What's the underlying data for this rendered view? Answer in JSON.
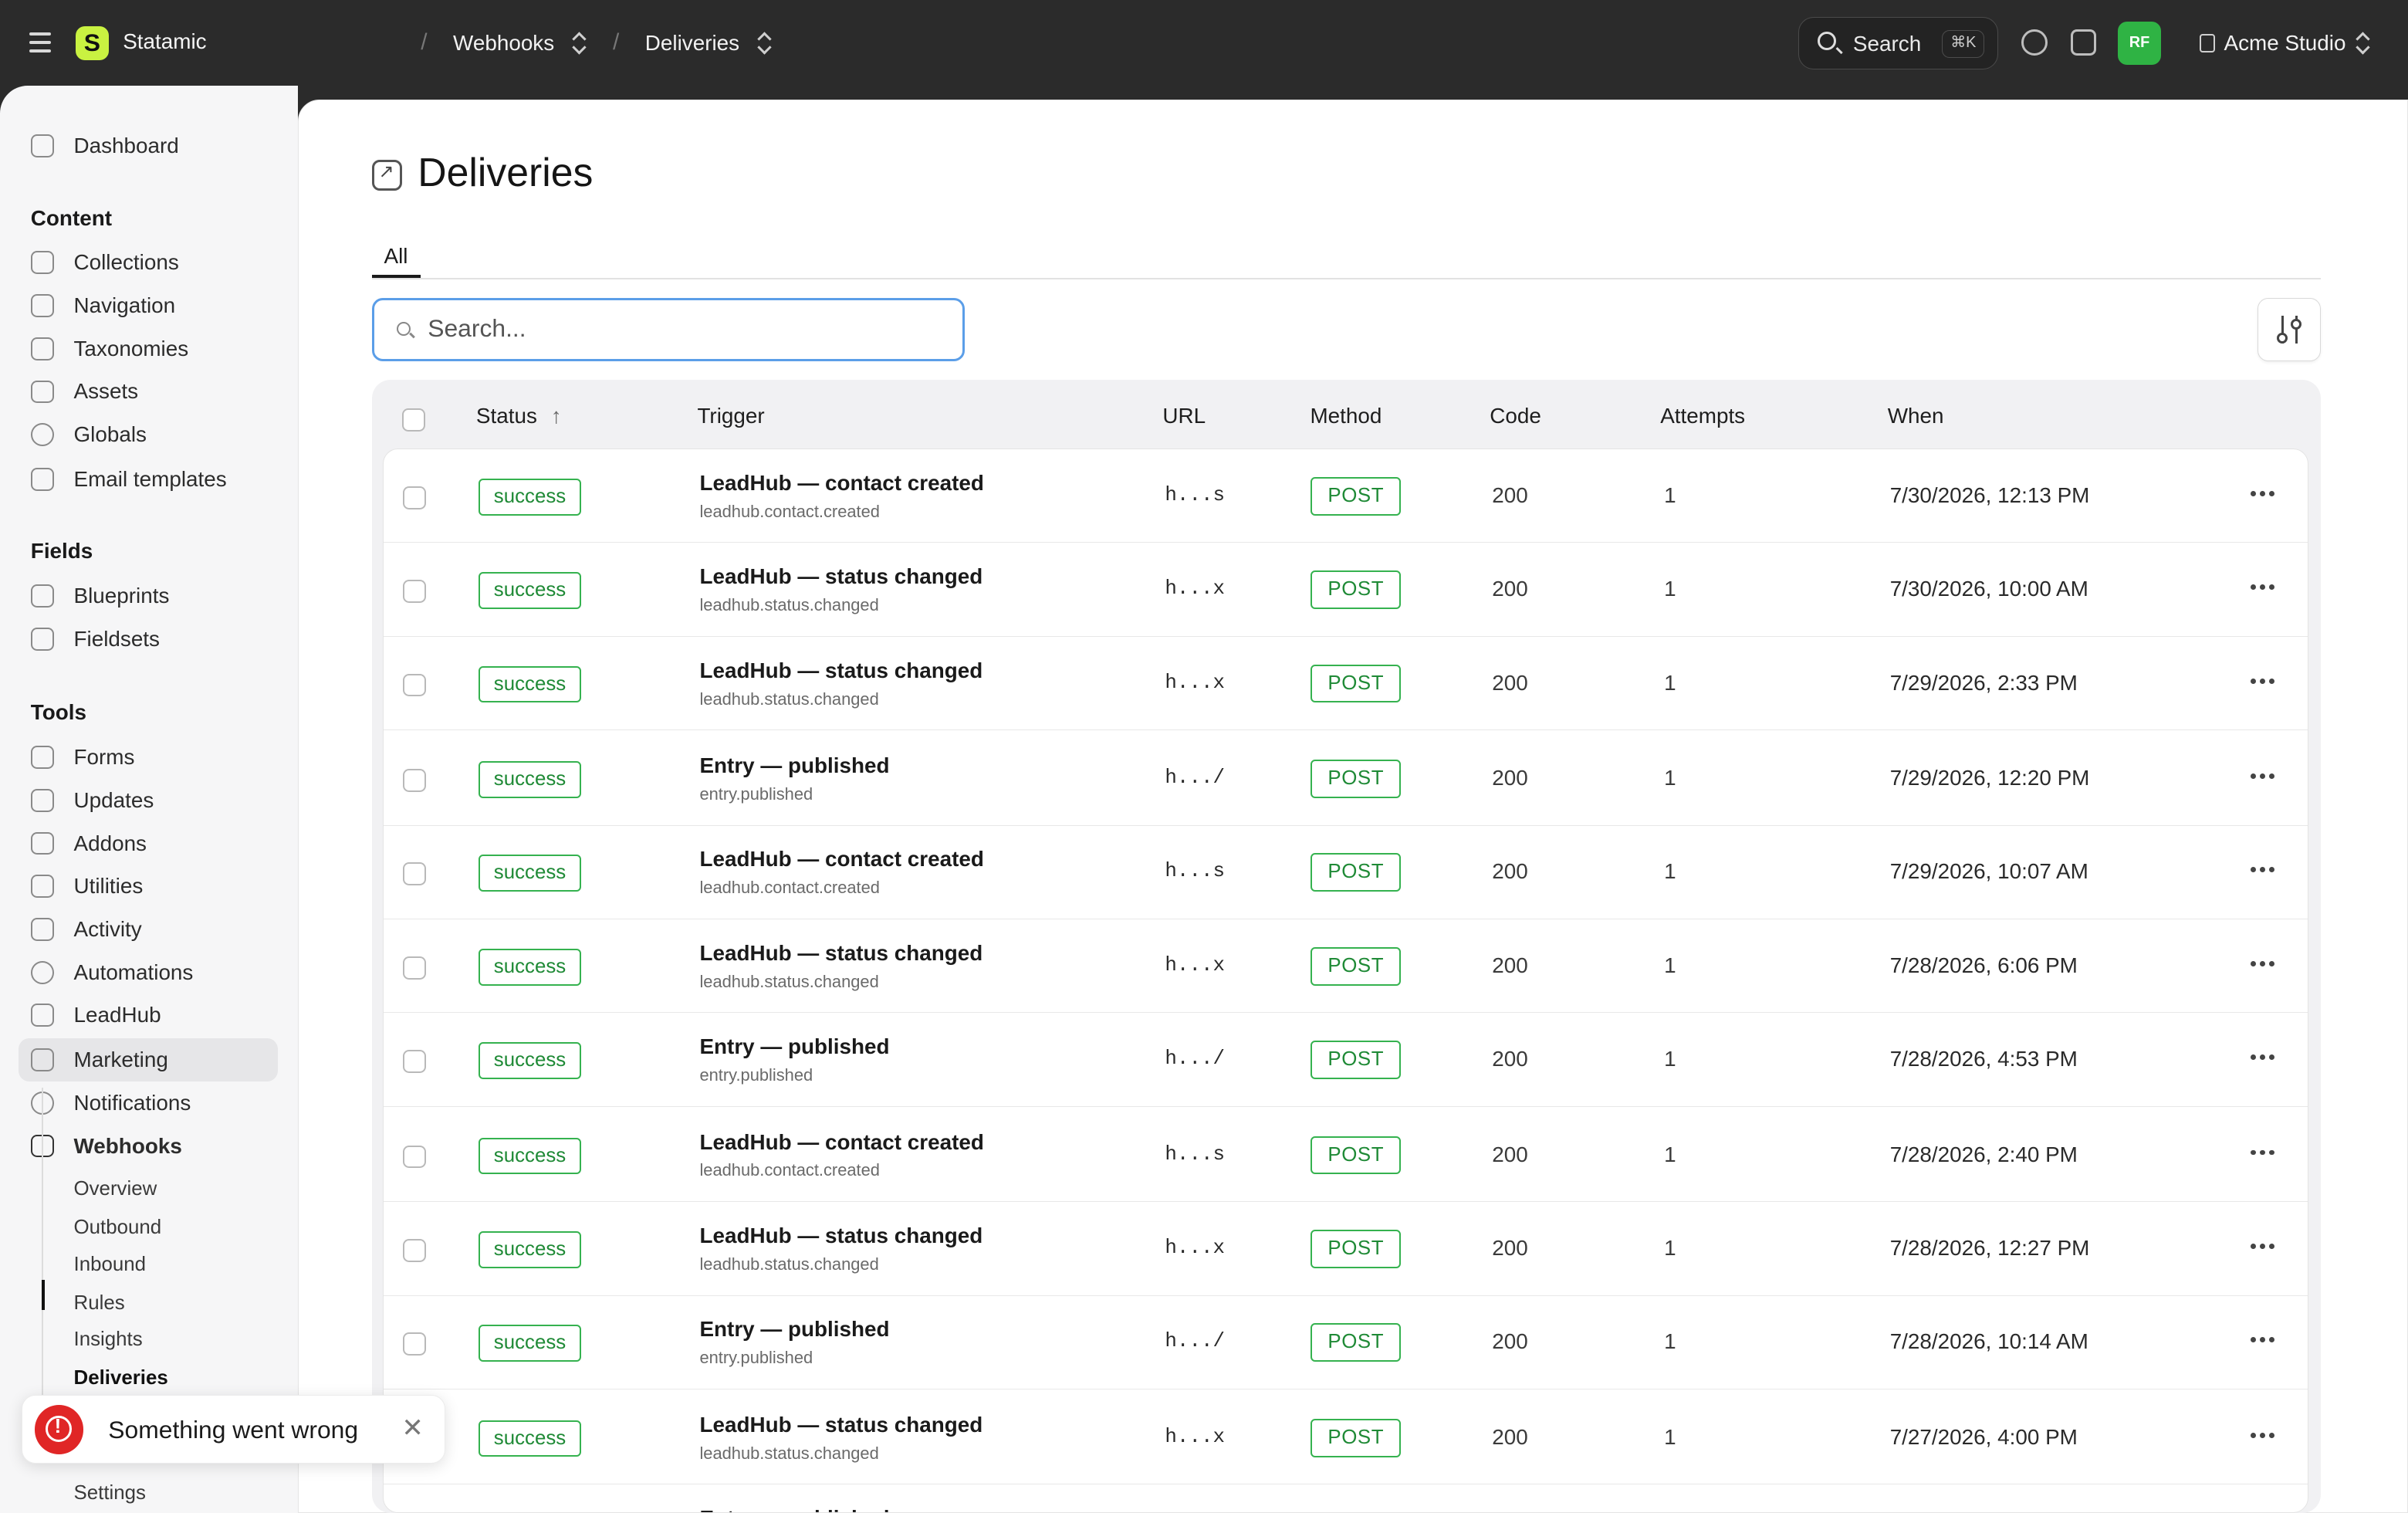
{
  "topbar": {
    "brand": "Statamic",
    "crumbs": [
      "Webhooks",
      "Deliveries"
    ],
    "search_label": "Search",
    "search_kbd": "⌘K",
    "avatar_initials": "RF",
    "site_name": "Acme Studio",
    "icons": [
      "menu-icon",
      "statamic-logo",
      "search-icon",
      "help-icon",
      "switch-site-icon"
    ]
  },
  "sidebar": {
    "dashboard": "Dashboard",
    "sections": [
      {
        "title": "Content",
        "items": [
          "Collections",
          "Navigation",
          "Taxonomies",
          "Assets",
          "Globals",
          "Email templates"
        ]
      },
      {
        "title": "Fields",
        "items": [
          "Blueprints",
          "Fieldsets"
        ]
      },
      {
        "title": "Tools",
        "items": [
          "Forms",
          "Updates",
          "Addons",
          "Utilities",
          "Activity",
          "Automations",
          "LeadHub",
          "Marketing",
          "Notifications",
          "Webhooks"
        ]
      }
    ],
    "active_item": "Webhooks",
    "subitems": [
      "Overview",
      "Outbound",
      "Inbound",
      "Rules",
      "Insights",
      "Deliveries",
      "Settings"
    ],
    "active_subitem": "Deliveries"
  },
  "page": {
    "title": "Deliveries",
    "tab": "All",
    "search_placeholder": "Search..."
  },
  "table": {
    "columns": [
      "Status",
      "Trigger",
      "URL",
      "Method",
      "Code",
      "Attempts",
      "When"
    ],
    "sort_column": "Status",
    "rows": [
      {
        "status": "success",
        "trigger": "LeadHub — contact created",
        "event": "leadhub.contact.created",
        "url": "h...s",
        "method": "POST",
        "code": "200",
        "attempts": "1",
        "when": "7/30/2026, 12:13 PM"
      },
      {
        "status": "success",
        "trigger": "LeadHub — status changed",
        "event": "leadhub.status.changed",
        "url": "h...x",
        "method": "POST",
        "code": "200",
        "attempts": "1",
        "when": "7/30/2026, 10:00 AM"
      },
      {
        "status": "success",
        "trigger": "LeadHub — status changed",
        "event": "leadhub.status.changed",
        "url": "h...x",
        "method": "POST",
        "code": "200",
        "attempts": "1",
        "when": "7/29/2026, 2:33 PM"
      },
      {
        "status": "success",
        "trigger": "Entry — published",
        "event": "entry.published",
        "url": "h.../",
        "method": "POST",
        "code": "200",
        "attempts": "1",
        "when": "7/29/2026, 12:20 PM"
      },
      {
        "status": "success",
        "trigger": "LeadHub — contact created",
        "event": "leadhub.contact.created",
        "url": "h...s",
        "method": "POST",
        "code": "200",
        "attempts": "1",
        "when": "7/29/2026, 10:07 AM"
      },
      {
        "status": "success",
        "trigger": "LeadHub — status changed",
        "event": "leadhub.status.changed",
        "url": "h...x",
        "method": "POST",
        "code": "200",
        "attempts": "1",
        "when": "7/28/2026, 6:06 PM"
      },
      {
        "status": "success",
        "trigger": "Entry — published",
        "event": "entry.published",
        "url": "h.../",
        "method": "POST",
        "code": "200",
        "attempts": "1",
        "when": "7/28/2026, 4:53 PM"
      },
      {
        "status": "success",
        "trigger": "LeadHub — contact created",
        "event": "leadhub.contact.created",
        "url": "h...s",
        "method": "POST",
        "code": "200",
        "attempts": "1",
        "when": "7/28/2026, 2:40 PM"
      },
      {
        "status": "success",
        "trigger": "LeadHub — status changed",
        "event": "leadhub.status.changed",
        "url": "h...x",
        "method": "POST",
        "code": "200",
        "attempts": "1",
        "when": "7/28/2026, 12:27 PM"
      },
      {
        "status": "success",
        "trigger": "Entry — published",
        "event": "entry.published",
        "url": "h.../",
        "method": "POST",
        "code": "200",
        "attempts": "1",
        "when": "7/28/2026, 10:14 AM"
      },
      {
        "status": "success",
        "trigger": "LeadHub — status changed",
        "event": "leadhub.status.changed",
        "url": "h...x",
        "method": "POST",
        "code": "200",
        "attempts": "1",
        "when": "7/27/2026, 4:00 PM"
      },
      {
        "status": "",
        "trigger": "Entry — published",
        "event": "",
        "url": "",
        "method": "",
        "code": "",
        "attempts": "",
        "when": ""
      }
    ]
  },
  "toast": {
    "message": "Something went wrong",
    "close": "✕"
  },
  "colors": {
    "topbar_bg": "#2b2b2b",
    "accent_green": "#35b24f",
    "focus_blue": "#5b9ee8",
    "error_red": "#e02626",
    "logo_lime": "#c9f241"
  }
}
